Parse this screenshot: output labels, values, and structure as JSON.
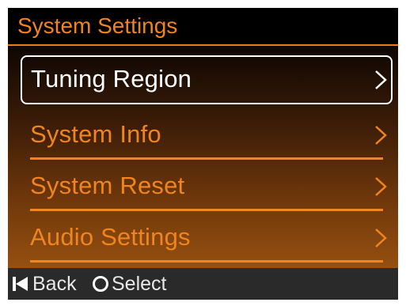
{
  "header": {
    "title": "System Settings"
  },
  "menu": {
    "items": [
      {
        "label": "Tuning Region",
        "selected": true,
        "chevron": "chevron-right-icon"
      },
      {
        "label": "System Info",
        "selected": false,
        "chevron": "chevron-right-icon"
      },
      {
        "label": "System Reset",
        "selected": false,
        "chevron": "chevron-right-icon"
      },
      {
        "label": "Audio Settings",
        "selected": false,
        "chevron": "chevron-right-icon"
      }
    ]
  },
  "footer": {
    "back_label": "Back",
    "back_icon": "skip-back-icon",
    "select_label": "Select",
    "select_icon": "circle-icon"
  },
  "colors": {
    "accent": "#f0841f",
    "selected_text": "#ffffff",
    "footer_bg": "#2a2a2a"
  }
}
